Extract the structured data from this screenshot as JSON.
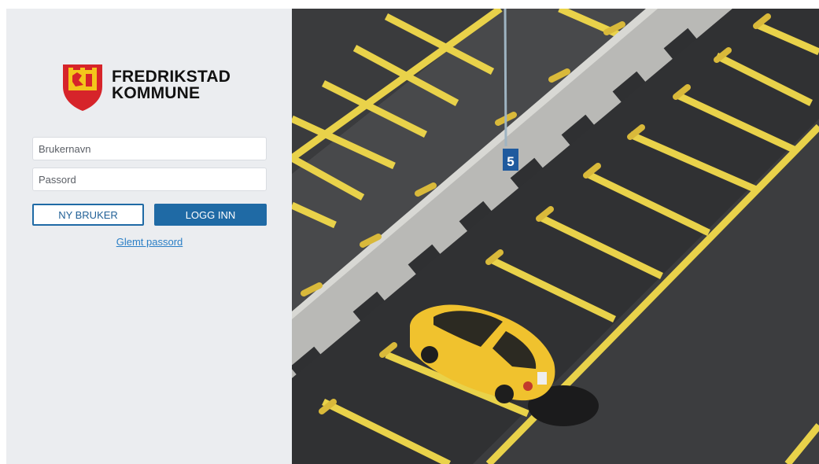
{
  "brand": {
    "line1": "FREDRIKSTAD",
    "line2": "KOMMUNE",
    "logo_icon": "coat-of-arms-icon",
    "colors": {
      "shield_red": "#d6242a",
      "shield_yellow": "#f3c61b"
    }
  },
  "form": {
    "username_placeholder": "Brukernavn",
    "password_placeholder": "Passord",
    "new_user_label": "NY BRUKER",
    "login_label": "LOGG INN",
    "forgot_label": "Glemt passord"
  },
  "photo": {
    "sign_number": "5"
  },
  "colors": {
    "accent": "#1f6aa5",
    "panel_bg": "#ebedf0",
    "link": "#2a7fc6"
  }
}
